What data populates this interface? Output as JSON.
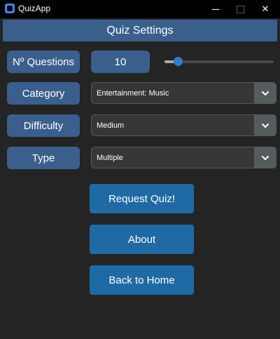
{
  "window": {
    "title": "QuizApp",
    "controls": {
      "minimize": "",
      "maximize": "",
      "close": "✕"
    }
  },
  "header": {
    "title": "Quiz Settings"
  },
  "settings": {
    "questions": {
      "label": "Nº Questions",
      "value": "10",
      "slider_fraction": 0.12
    },
    "category": {
      "label": "Category",
      "selected": "Entertainment: Music"
    },
    "difficulty": {
      "label": "Difficulty",
      "selected": "Medium"
    },
    "type": {
      "label": "Type",
      "selected": "Multiple"
    }
  },
  "actions": {
    "request": "Request Quiz!",
    "about": "About",
    "back": "Back to Home"
  },
  "colors": {
    "background": "#242424",
    "header": "#3a5f8c",
    "button": "#1f6aa5",
    "slider_thumb": "#2f7dd1"
  },
  "icons": {
    "app": "app-icon",
    "dropdown": "chevron-down-icon"
  }
}
